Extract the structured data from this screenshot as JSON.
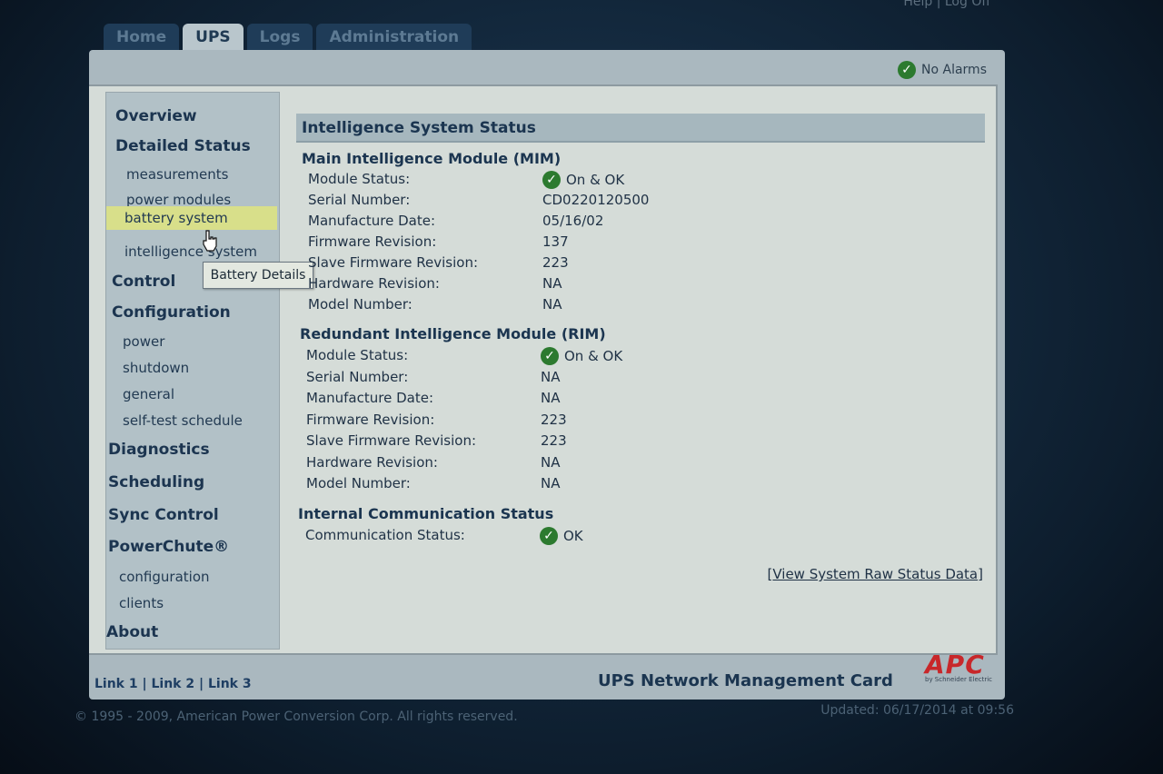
{
  "header": {
    "top_right": "Help | Log Off",
    "tabs": [
      {
        "label": "Home",
        "active": false
      },
      {
        "label": "UPS",
        "active": true
      },
      {
        "label": "Logs",
        "active": false
      },
      {
        "label": "Administration",
        "active": false
      }
    ],
    "alarm_status": "No Alarms"
  },
  "sidebar": {
    "overview": "Overview",
    "detailed_status": "Detailed Status",
    "measurements": "measurements",
    "power_modules": "power modules",
    "battery_system": "battery system",
    "intelligence_system": "intelligence system",
    "tooltip": "Battery Details",
    "control": "Control",
    "configuration": "Configuration",
    "power": "power",
    "shutdown": "shutdown",
    "general": "general",
    "self_test_schedule": "self-test schedule",
    "diagnostics": "Diagnostics",
    "scheduling": "Scheduling",
    "sync_control": "Sync Control",
    "powerchute": "PowerChute®",
    "pc_configuration": "configuration",
    "clients": "clients",
    "about": "About"
  },
  "main": {
    "title": "Intelligence System Status",
    "mim": {
      "title": "Main Intelligence Module (MIM)",
      "rows": [
        {
          "label": "Module Status:",
          "value": "On & OK",
          "ok_icon": true
        },
        {
          "label": "Serial Number:",
          "value": "CD0220120500"
        },
        {
          "label": "Manufacture Date:",
          "value": "05/16/02"
        },
        {
          "label": "Firmware Revision:",
          "value": "137"
        },
        {
          "label": "Slave Firmware Revision:",
          "value": "223"
        },
        {
          "label": "Hardware Revision:",
          "value": "NA"
        },
        {
          "label": "Model Number:",
          "value": "NA"
        }
      ]
    },
    "rim": {
      "title": "Redundant Intelligence Module (RIM)",
      "rows": [
        {
          "label": "Module Status:",
          "value": "On & OK",
          "ok_icon": true
        },
        {
          "label": "Serial Number:",
          "value": "NA"
        },
        {
          "label": "Manufacture Date:",
          "value": "NA"
        },
        {
          "label": "Firmware Revision:",
          "value": "223"
        },
        {
          "label": "Slave Firmware Revision:",
          "value": "223"
        },
        {
          "label": "Hardware Revision:",
          "value": "NA"
        },
        {
          "label": "Model Number:",
          "value": "NA"
        }
      ]
    },
    "comm": {
      "title": "Internal Communication Status",
      "rows": [
        {
          "label": "Communication Status:",
          "value": "OK",
          "ok_icon": true
        }
      ]
    },
    "raw_link": "View System Raw Status Data"
  },
  "footer": {
    "link1": "Link 1",
    "link2": "Link 2",
    "link3": "Link 3",
    "card_title": "UPS Network Management Card",
    "logo_text": "APC",
    "logo_sub": "by Schneider Electric",
    "copyright": "© 1995 - 2009, American Power Conversion Corp. All rights reserved.",
    "updated": "Updated: 06/17/2014 at 09:56"
  },
  "colors": {
    "accent_navy": "#1b3550",
    "highlight": "#d8df8a",
    "ok_green": "#2c7a2f",
    "apc_red": "#c8272a"
  }
}
